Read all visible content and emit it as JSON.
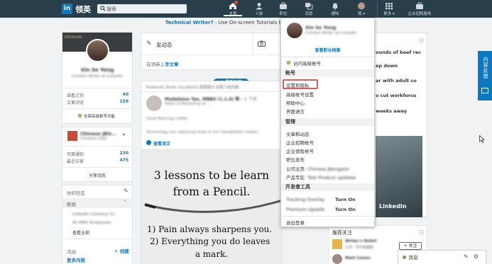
{
  "top": {
    "logo": "in",
    "brand": "领英",
    "search_placeholder": "搜索",
    "nav": [
      {
        "label": "主页",
        "active": true
      },
      {
        "label": "人脉"
      },
      {
        "label": "职位"
      },
      {
        "label": "消息"
      },
      {
        "label": "通知"
      },
      {
        "label": "我 ▾"
      },
      {
        "label": "更多 ▾"
      },
      {
        "label": "企业招聘服务"
      }
    ]
  },
  "banner": {
    "strong": "Technical Writer?",
    "rest": " - Use On-screen Tutorials to Easily Guide Use"
  },
  "profile": {
    "tag": "PREMIUM",
    "name": "Xin Se Yong",
    "subtitle": "Content Writer at Linkedin",
    "stat1_label": "谁看过你",
    "stat1_value": "40",
    "stat2_label": "文章浏览",
    "stat2_value": "159",
    "premium_link": "全部高级帐号功能"
  },
  "company": {
    "name": "Chinese JBU...",
    "sub": "Company page",
    "stat1_label": "页面通知",
    "stat1_value": "230",
    "stat2_label": "最近访客",
    "stat2_value": "475",
    "share": "分享动态"
  },
  "community": {
    "title": "你的社区",
    "groups": "群组",
    "group1": "LinkedIn Company Gr...",
    "group2": "All APAC Employees",
    "view_all": "查看全部",
    "events": "活动",
    "create": "+ 创建",
    "more": "更多内容"
  },
  "composer": {
    "post": "发动态",
    "write_prefix": "在领英上",
    "write_link": "写文章"
  },
  "new_updates": "↑ 最新动态",
  "feed": {
    "actor": "Prathinth (Prath Gundlach)",
    "actor_meta": "和其他人点赞了此内容",
    "author": "Madeleine Tan, MBBS (1.1.4) 等",
    "author_title": "Head of Marketing at ...",
    "time": "1 个月",
    "line1": "Good Morning Coffee",
    "line2": "Technology has replacing most of our handwritten habits...",
    "translate": "查看译文",
    "img_line1": "3 lessons to be learn",
    "img_line2": "from a Pencil.",
    "img_line3": "1) Pain always sharpens you.",
    "img_line4": "2) Everything you do leaves",
    "img_line5": "a mark."
  },
  "menu": {
    "name": "Xin Se Yong",
    "title": "Content Writer at LinkedIn",
    "view_profile": "查看职业档案",
    "premium": "访问高级帐号",
    "sec_account": "帐号",
    "settings": "设置和隐私",
    "premium_settings": "高级帐号设置",
    "help": "帮助中心",
    "language": "界面语言",
    "sec_manage": "管理",
    "posts": "文章和动态",
    "recruiter": "企业招聘帐号",
    "sales": "企业销售帐号",
    "jobs": "职位发布",
    "company_page": "公司主页: ",
    "company_page_val": "Chinese JBangalor",
    "showcase": "产品专区: ",
    "showcase_val": "Test Product updates",
    "sec_dev": "开发者工具",
    "tool1": "Tracking Overlay",
    "tool1_state": "Turn On",
    "tool2": "Premium Upsells",
    "tool2_state": "Turn On",
    "logout": "退出登录"
  },
  "news": {
    "items": [
      "ounds of beef rec",
      "ep down",
      "ar with adult co",
      "o cut workforce",
      "weeks away"
    ]
  },
  "follow": {
    "title": "推荐关注",
    "person1": "Writer's Relief",
    "person1_sub": "公司 · 写作和编辑",
    "follow_btn": "+ 关注",
    "person2": "Matt Cohen"
  },
  "ad_text": "LinkedIn",
  "feedback": "内容反馈",
  "messages": "消息"
}
